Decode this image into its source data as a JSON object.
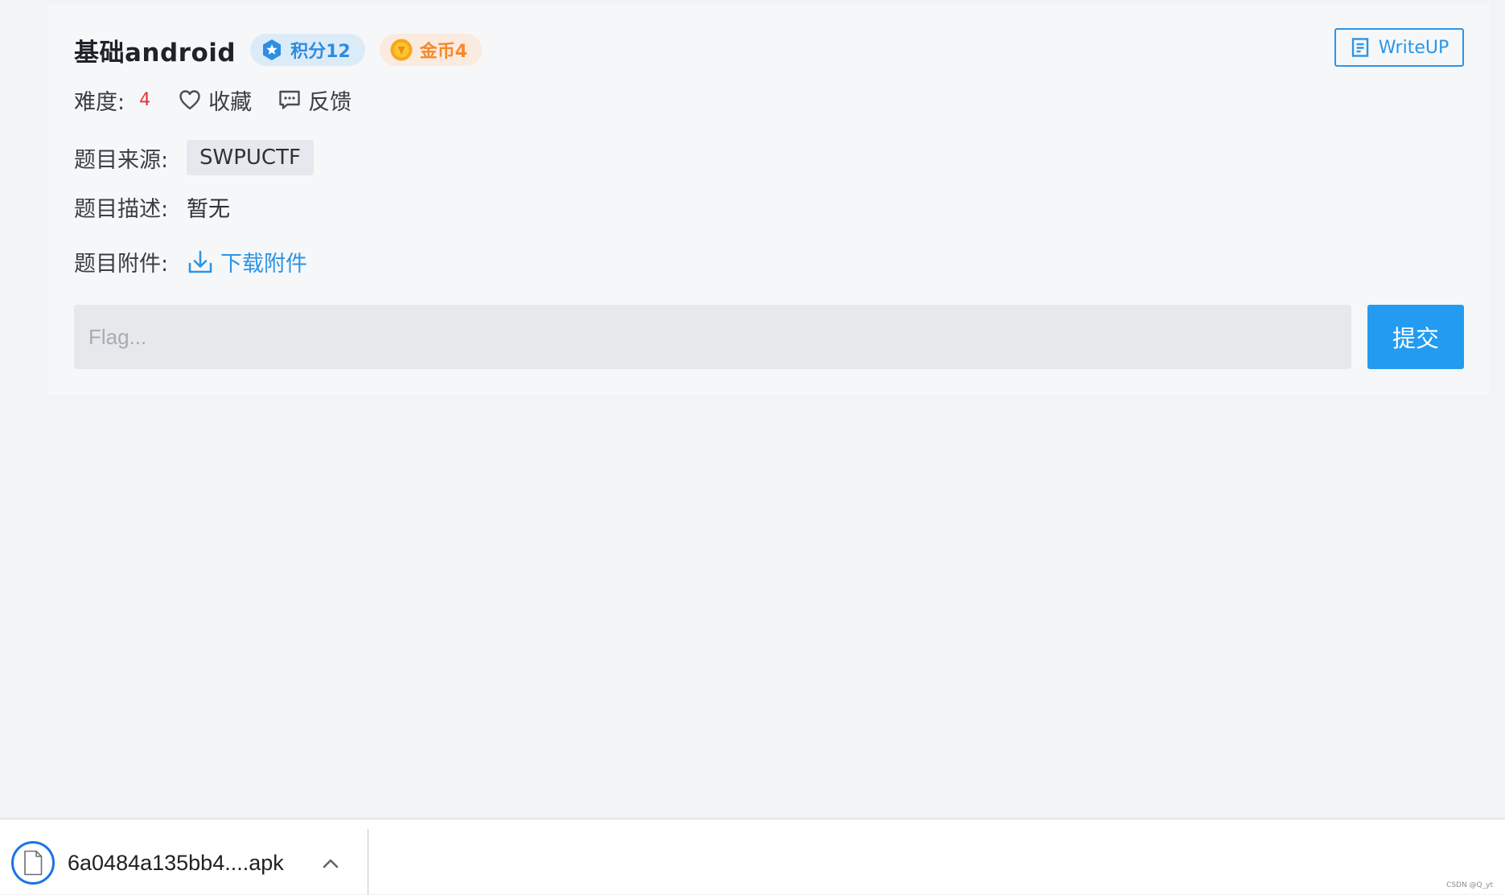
{
  "challenge": {
    "title": "基础android",
    "score_label": "积分12",
    "coin_label": "金币4",
    "writeup_label": "WriteUP"
  },
  "meta": {
    "difficulty_label": "难度:",
    "difficulty_value": "4",
    "favorite_label": "收藏",
    "feedback_label": "反馈"
  },
  "fields": {
    "source_label": "题目来源:",
    "source_value": "SWPUCTF",
    "description_label": "题目描述:",
    "description_value": "暂无",
    "attachment_label": "题目附件:",
    "attachment_link": "下载附件"
  },
  "flag_form": {
    "placeholder": "Flag...",
    "submit_label": "提交"
  },
  "download_bar": {
    "file_name": "6a0484a135bb4....apk"
  },
  "watermark": "CSDN @Q_yt",
  "colors": {
    "accent_blue": "#229bf0",
    "score_blue": "#2d8ce0",
    "coin_orange": "#f5892a",
    "difficulty_red": "#e0353b"
  },
  "icons": {
    "score": "star-hexagon-icon",
    "coin": "coin-icon",
    "writeup": "document-icon",
    "favorite": "heart-icon",
    "feedback": "comment-icon",
    "attachment": "download-icon",
    "file": "file-icon",
    "chevron": "chevron-up-icon"
  }
}
